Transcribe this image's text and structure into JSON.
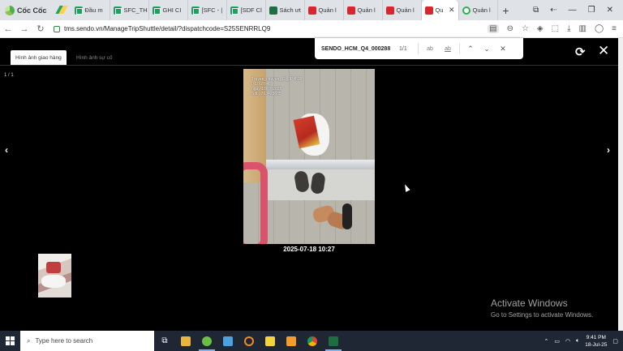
{
  "browser": {
    "brand": "Cốc Cốc",
    "tabs": [
      {
        "label": "Đầu m",
        "icon": "sheet"
      },
      {
        "label": "SFC_TH",
        "icon": "sheet"
      },
      {
        "label": "GHI CI",
        "icon": "sheet"
      },
      {
        "label": "[SFC - |",
        "icon": "sheet"
      },
      {
        "label": "[SDF Cl",
        "icon": "sheet"
      },
      {
        "label": "Sách ưt",
        "icon": "xls"
      },
      {
        "label": "Quản l",
        "icon": "red"
      },
      {
        "label": "Quản l",
        "icon": "red"
      },
      {
        "label": "Quản l",
        "icon": "red"
      },
      {
        "label": "Qu",
        "icon": "red",
        "active": true
      },
      {
        "label": "Quản l",
        "icon": "green-o"
      }
    ],
    "url": "tms.sendo.vn/ManageTripShuttle/detail/?dispatchcode=S25SENRRLQ9"
  },
  "find_bar": {
    "query": "SENDO_HCM_Q4_000288",
    "count": "1/1",
    "opt_case": "ab",
    "opt_word": "ab"
  },
  "viewer": {
    "tab_delivery": "Hình ảnh giao hàng",
    "tab_incident": "Hình ảnh sự cố",
    "counter": "1 / 1",
    "photo_stamp": "Truyen_chuyen_19_JP4515\n0 10:27:46\nngay 18/07/2025\nSdt 0763425685",
    "timestamp": "2025-07-18 10:27"
  },
  "watermark": {
    "line1": "Activate Windows",
    "line2": "Go to Settings to activate Windows."
  },
  "taskbar": {
    "search_placeholder": "Type here to search",
    "time": "9:41 PM",
    "date": "18-Jul-25"
  }
}
